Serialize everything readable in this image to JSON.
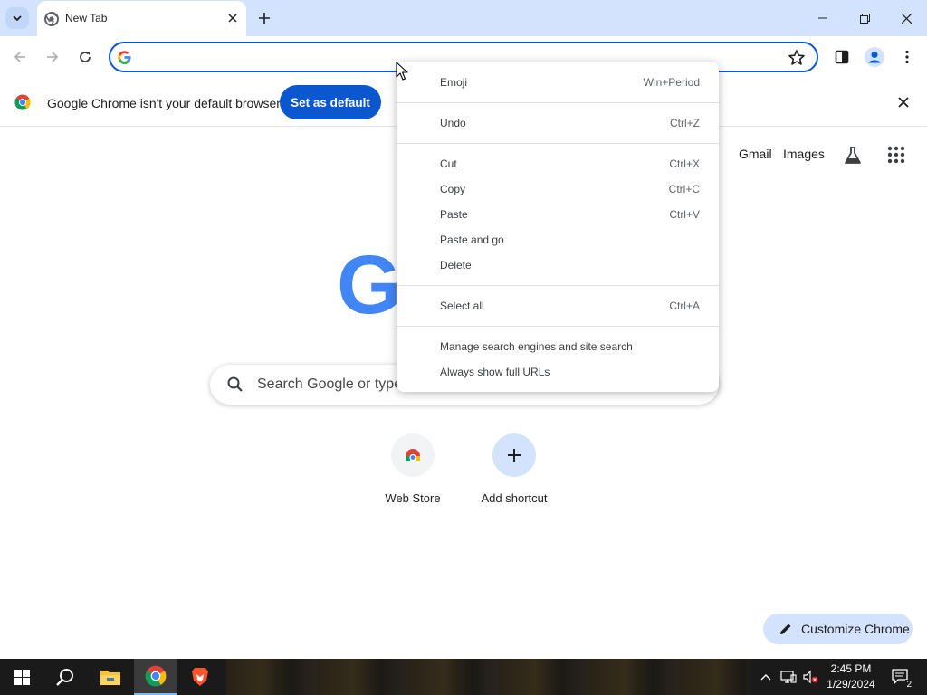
{
  "tabstrip": {
    "tab_title": "New Tab"
  },
  "infobar": {
    "message": "Google Chrome isn't your default browser",
    "button_label": "Set as default"
  },
  "ntp": {
    "links": [
      "Gmail",
      "Images"
    ],
    "logo_letter": "G",
    "search_placeholder": "Search Google or type",
    "shortcuts": [
      {
        "label": "Web Store",
        "icon": "web-store-icon"
      },
      {
        "label": "Add shortcut",
        "icon": "plus-icon"
      }
    ],
    "customize_label": "Customize Chrome"
  },
  "context_menu": {
    "items": [
      {
        "label": "Emoji",
        "shortcut": "Win+Period"
      },
      {
        "label": "Undo",
        "shortcut": "Ctrl+Z"
      },
      {
        "label": "Cut",
        "shortcut": "Ctrl+X"
      },
      {
        "label": "Copy",
        "shortcut": "Ctrl+C"
      },
      {
        "label": "Paste",
        "shortcut": "Ctrl+V"
      },
      {
        "label": "Paste and go",
        "shortcut": ""
      },
      {
        "label": "Delete",
        "shortcut": ""
      },
      {
        "label": "Select all",
        "shortcut": "Ctrl+A"
      },
      {
        "label": "Manage search engines and site search",
        "shortcut": ""
      },
      {
        "label": "Always show full URLs",
        "shortcut": ""
      }
    ]
  },
  "taskbar": {
    "time": "2:45 PM",
    "date": "1/29/2024",
    "notification_count": "2"
  },
  "colors": {
    "accent": "#0b57d0",
    "tabstrip": "#d3e3fd",
    "google_blue": "#4285f4"
  }
}
